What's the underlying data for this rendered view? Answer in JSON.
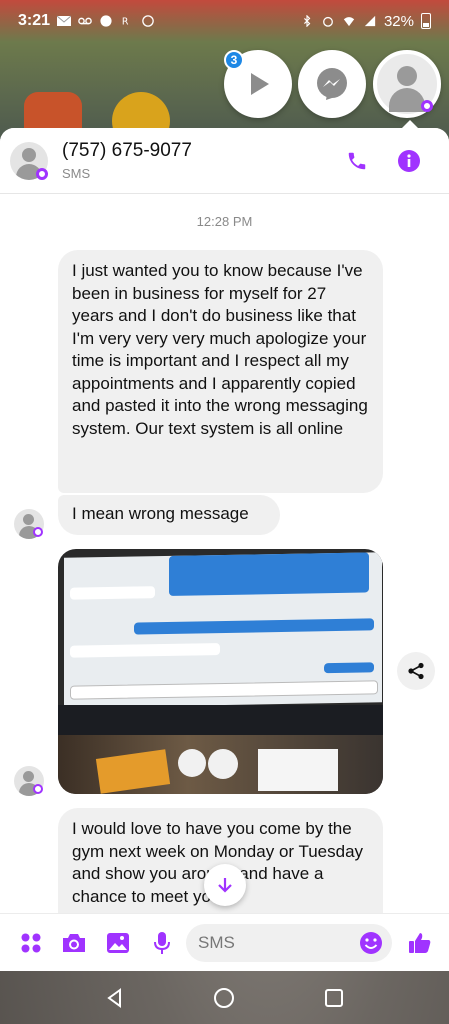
{
  "status_bar": {
    "time": "3:21",
    "battery": "32%"
  },
  "chat_heads": {
    "badge_count": "3"
  },
  "header": {
    "name": "(757) 675-9077",
    "subtitle": "SMS"
  },
  "conversation": {
    "timestamp": "12:28 PM",
    "messages": [
      {
        "text": "I just wanted you to know because I've been in business for myself for 27 years and I don't do business like that I'm very very very much apologize your time is important and I respect all my appointments and I apparently copied and pasted it into the wrong messaging system. Our text system is all online"
      },
      {
        "text": "I mean wrong message"
      },
      {
        "text": "I would love to have you come by the gym next week on Monday or Tuesday and show you around and have a chance to meet you"
      }
    ]
  },
  "composer": {
    "placeholder": "SMS"
  },
  "colors": {
    "accent": "#a033ff",
    "bubble_bg": "#f0f0f0",
    "badge_blue": "#1e88e5"
  },
  "icons": [
    "phone-icon",
    "info-icon",
    "share-icon",
    "arrow-down-icon",
    "menu-dots-icon",
    "camera-icon",
    "image-icon",
    "mic-icon",
    "emoji-icon",
    "thumbs-up-icon",
    "back-icon",
    "home-icon",
    "recents-icon",
    "play-icon",
    "messenger-icon"
  ]
}
